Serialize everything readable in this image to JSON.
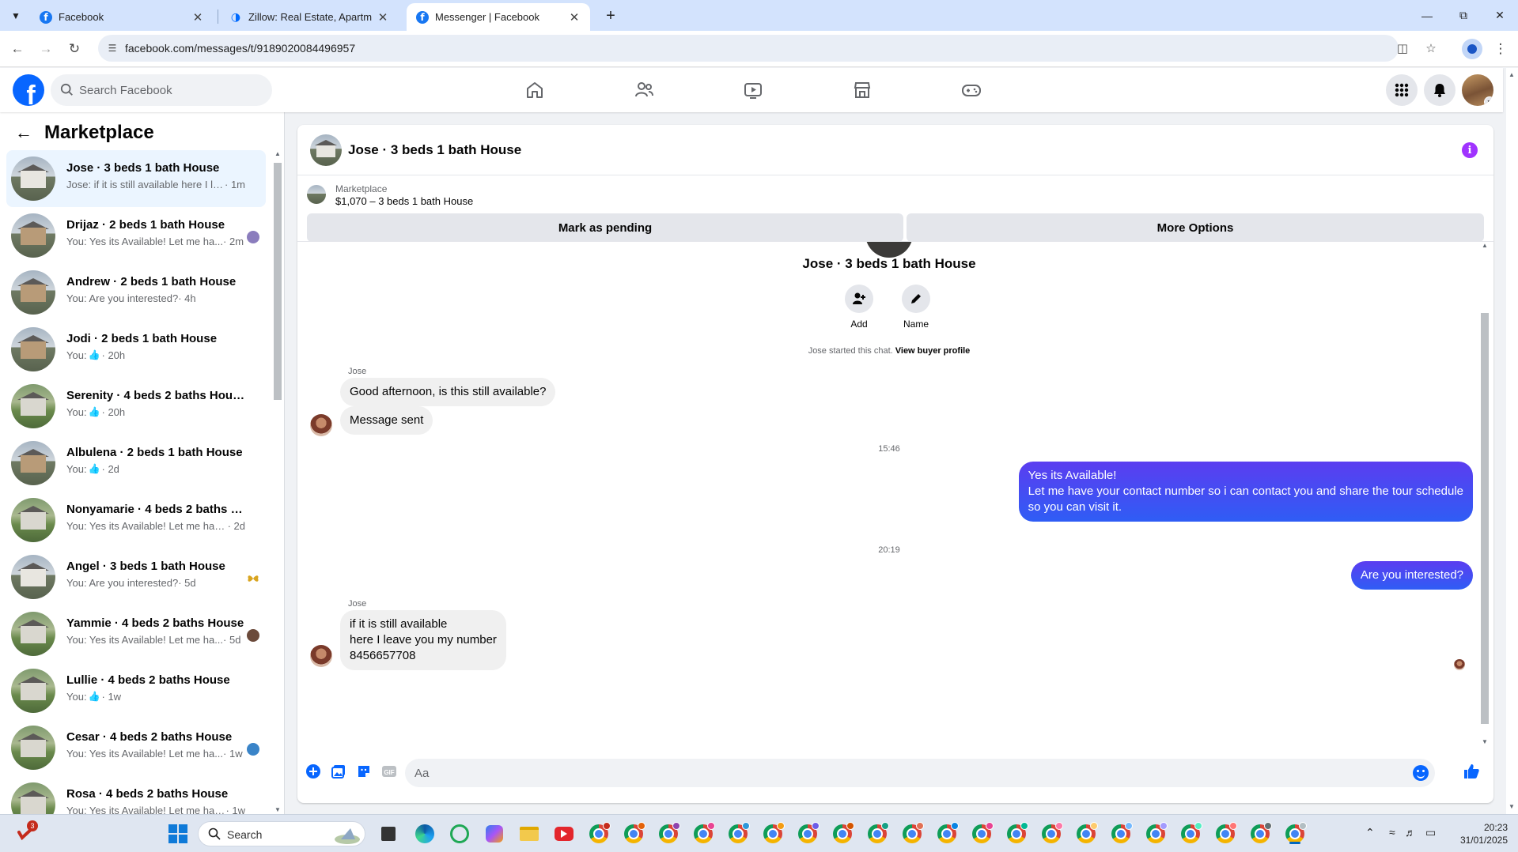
{
  "browser": {
    "tabs": [
      {
        "title": "Facebook",
        "icon": "facebook-icon",
        "active": false
      },
      {
        "title": "Zillow: Real Estate, Apartments,",
        "icon": "zillow-icon",
        "active": false
      },
      {
        "title": "Messenger | Facebook",
        "icon": "facebook-icon",
        "active": true
      }
    ],
    "url": "facebook.com/messages/t/9189020084496957"
  },
  "fb": {
    "search_placeholder": "Search Facebook",
    "logo": "f",
    "accent": "#0866ff"
  },
  "sidebar": {
    "title": "Marketplace",
    "conversations": [
      {
        "title": "Jose · 3 beds 1 bath House",
        "message": "Jose: if it is still available here I lea...",
        "time": " · 1m",
        "like": false,
        "active": true,
        "seen": "none"
      },
      {
        "title": "Drijaz · 2 beds 1 bath House",
        "message": "You: Yes its Available! Let me ha...",
        "time": " · 2m",
        "like": false,
        "active": false,
        "seen": "purple"
      },
      {
        "title": "Andrew · 2 beds 1 bath House",
        "message": "You: Are you interested?",
        "time": " · 4h",
        "like": false,
        "active": false,
        "seen": "none"
      },
      {
        "title": "Jodi · 2 beds 1 bath House",
        "message": "You: ",
        "time": " · 20h",
        "like": true,
        "active": false,
        "seen": "none"
      },
      {
        "title": "Serenity · 4 beds 2 baths House",
        "message": "You: ",
        "time": " · 20h",
        "like": true,
        "active": false,
        "seen": "none"
      },
      {
        "title": "Albulena · 2 beds 1 bath House",
        "message": "You: ",
        "time": " · 2d",
        "like": true,
        "active": false,
        "seen": "none"
      },
      {
        "title": "Nonyamarie · 4 beds 2 baths Ho...",
        "message": "You: Yes its Available! Let me have ...",
        "time": " · 2d",
        "like": false,
        "active": false,
        "seen": "none"
      },
      {
        "title": "Angel · 3 beds 1 bath House",
        "message": "You: Are you interested?",
        "time": " · 5d",
        "like": false,
        "active": false,
        "seen": "butterfly"
      },
      {
        "title": "Yammie · 4 beds 2 baths House",
        "message": "You: Yes its Available! Let me ha...",
        "time": " · 5d",
        "like": false,
        "active": false,
        "seen": "brown"
      },
      {
        "title": "Lullie · 4 beds 2 baths House",
        "message": "You: ",
        "time": " · 1w",
        "like": true,
        "active": false,
        "seen": "none"
      },
      {
        "title": "Cesar · 4 beds 2 baths House",
        "message": "You: Yes its Available! Let me ha...",
        "time": " · 1w",
        "like": false,
        "active": false,
        "seen": "globe"
      },
      {
        "title": "Rosa · 4 beds 2 baths House",
        "message": "You: Yes its Available! Let me have ...",
        "time": " · 1w",
        "like": false,
        "active": false,
        "seen": "none"
      }
    ]
  },
  "chat": {
    "header_name": "Jose · 3 beds 1 bath House",
    "listing_source": "Marketplace",
    "listing_title": "$1,070 – 3 beds 1 bath House",
    "mark_pending": "Mark as pending",
    "more_options": "More Options",
    "conversation_name": "Jose · 3 beds 1 bath House",
    "add_label": "Add",
    "name_label": "Name",
    "started_text": "Jose started this chat. ",
    "view_profile": "View buyer profile",
    "sender1": "Jose",
    "msg1": "Good afternoon, is this still available?",
    "msg2": "Message sent",
    "time1": "15:46",
    "out1_lines": [
      "Yes its Available!",
      "Let me have your contact number so i can contact you and share the tour schedule",
      "so you can visit it."
    ],
    "time2": "20:19",
    "out2": "Are you interested?",
    "sender2": "Jose",
    "in3_lines": [
      "if it is still available",
      "here I leave you my number",
      "8456657708"
    ],
    "composer_placeholder": "Aa"
  },
  "taskbar": {
    "search_label": "Search",
    "time": "20:23",
    "date": "31/01/2025",
    "notification_count": "3"
  }
}
